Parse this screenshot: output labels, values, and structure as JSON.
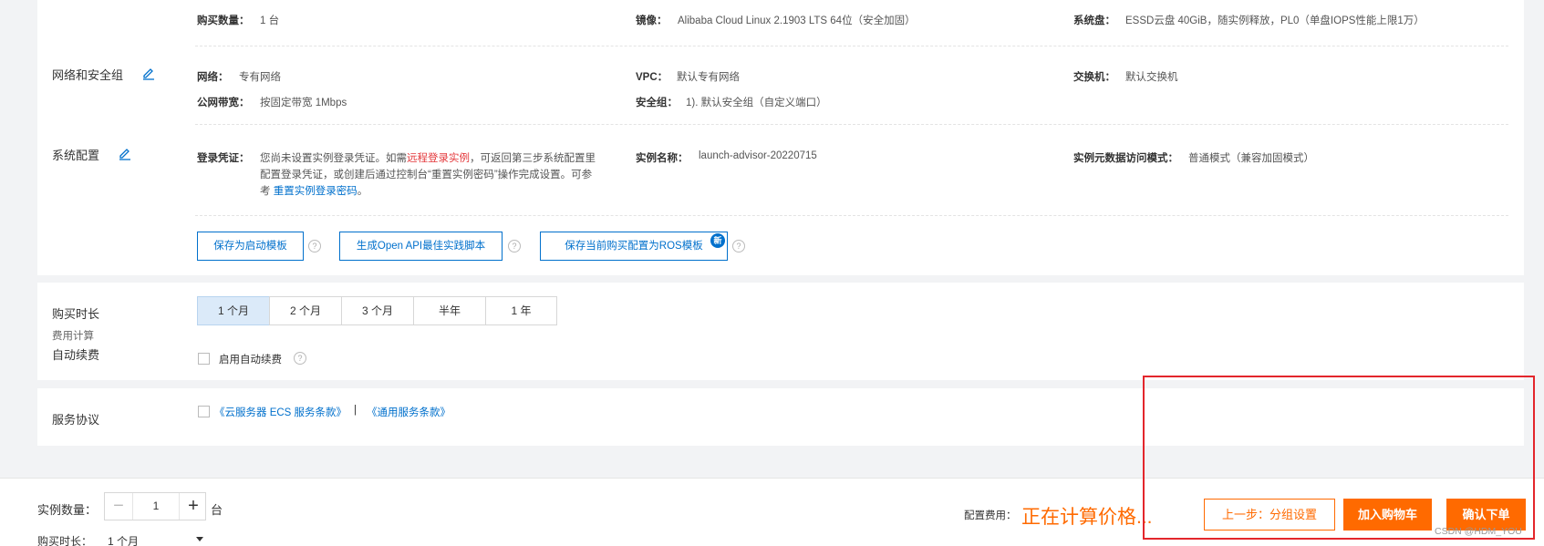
{
  "top": {
    "row1": {
      "qty_key": "购买数量：",
      "qty_val": "1 台",
      "image_key": "镜像：",
      "image_val": "Alibaba Cloud Linux 2.1903 LTS 64位（安全加固）",
      "disk_key": "系统盘：",
      "disk_val": "ESSD云盘 40GiB，随实例释放，PL0（单盘IOPS性能上限1万）"
    },
    "network": {
      "title": "网络和安全组",
      "net_key": "网络：",
      "net_val": "专有网络",
      "vpc_key": "VPC：",
      "vpc_val": "默认专有网络",
      "switch_key": "交换机：",
      "switch_val": "默认交换机",
      "bw_key": "公网带宽：",
      "bw_val": "按固定带宽 1Mbps",
      "sg_key": "安全组：",
      "sg_val": "1). 默认安全组（自定义端口）"
    },
    "system": {
      "title": "系统配置",
      "login_key": "登录凭证：",
      "login_line1_a": "您尚未设置实例登录凭证。如需",
      "login_line1_link": "远程登录实例",
      "login_line1_b": "，可返回第三步系统配置里",
      "login_line2": "配置登录凭证，或创建后通过控制台“重置实例密码”操作完成设置。可参",
      "login_line3_a": "考 ",
      "login_line3_link": "重置实例登录密码",
      "login_line3_b": "。",
      "name_key": "实例名称：",
      "name_val": "launch-advisor-20220715",
      "meta_key": "实例元数据访问模式：",
      "meta_val": "普通模式（兼容加固模式）"
    },
    "buttons": {
      "save_tpl": "保存为启动模板",
      "gen_api": "生成Open API最佳实践脚本",
      "save_ros": "保存当前购买配置为ROS模板",
      "new_badge": "新",
      "help": "?"
    }
  },
  "duration": {
    "title": "购买时长",
    "fee_label": "费用计算",
    "options": [
      "1 个月",
      "2 个月",
      "3 个月",
      "半年",
      "1 年"
    ],
    "selected": 0,
    "auto_title": "自动续费",
    "auto_label": "启用自动续费"
  },
  "service": {
    "title": "服务协议",
    "link1": "《云服务器 ECS 服务条款》",
    "sep": "|",
    "link2": "《通用服务条款》"
  },
  "bottom": {
    "qty_label": "实例数量：",
    "qty_value": "1",
    "qty_unit": "台",
    "duration_label": "购买时长：",
    "duration_value": "1 个月",
    "fee_label": "配置费用：",
    "fee_value": "正在计算价格...",
    "prev_btn": "上一步：分组设置",
    "cart_btn": "加入购物车",
    "order_btn": "确认下单",
    "watermark": "CSDN @HDM_YOU"
  },
  "colors": {
    "accent": "#0070cc",
    "orange": "#ff6a00",
    "highlight": "#e3262c"
  }
}
